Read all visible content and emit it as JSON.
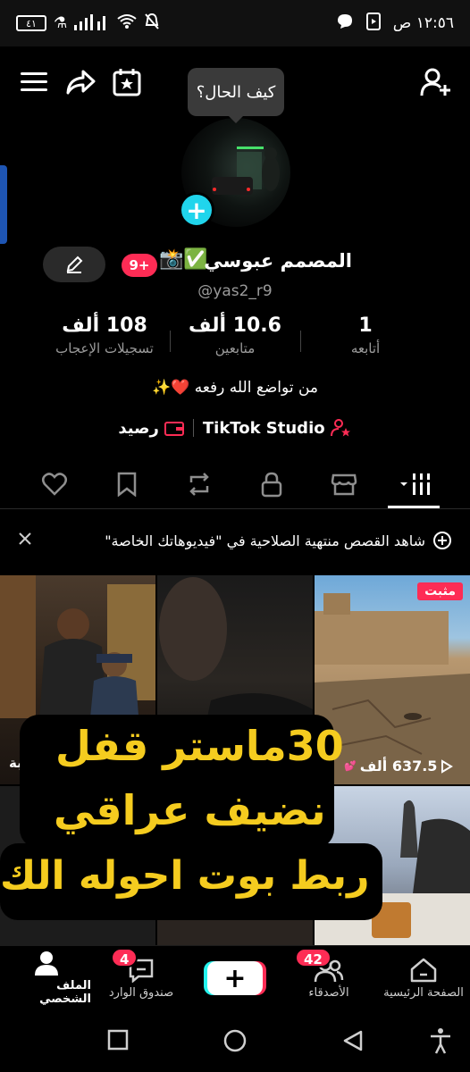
{
  "status_bar": {
    "time": "١٢:٥٦ ص",
    "battery": "٤١"
  },
  "header": {
    "tooltip": "كيف الحال؟"
  },
  "profile": {
    "display_name": "المصمم عبوسي",
    "emojis": "📸✅",
    "notif_badge": "9+",
    "username": "@yas2_r9",
    "bio": "من تواضع الله رفعه ❤️✨",
    "studio_label": "TikTok Studio",
    "balance_label": "رصيد"
  },
  "stats": [
    {
      "number": "1",
      "label": "أتابعه"
    },
    {
      "number": "10.6 ألف",
      "label": "متابعين"
    },
    {
      "number": "108 ألف",
      "label": "تسجيلات الإعجاب"
    }
  ],
  "tabs": [
    "videos-grid",
    "shop",
    "private",
    "reposts",
    "favorites",
    "liked"
  ],
  "banner": {
    "text": "شاهد القصص منتهية الصلاحية في \"فيديوهاتك الخاصة\""
  },
  "grid": {
    "pinned_label": "مثبت",
    "views": "637.5 ألف",
    "side_text": "بة",
    "overlay_lines": [
      "30ماستر قفل",
      "نضيف عراقي",
      "ربط بوت احوله الك"
    ]
  },
  "bottom_nav": {
    "home": "الصفحة الرئيسية",
    "friends": "الأصدقاء",
    "friends_badge": "42",
    "inbox": "صندوق الوارد",
    "inbox_badge": "4",
    "profile": "الملف الشخصي"
  },
  "colors": {
    "accent_red": "#fe2c55",
    "accent_cyan": "#20d5ec",
    "overlay_yellow": "#f5cc1f"
  }
}
